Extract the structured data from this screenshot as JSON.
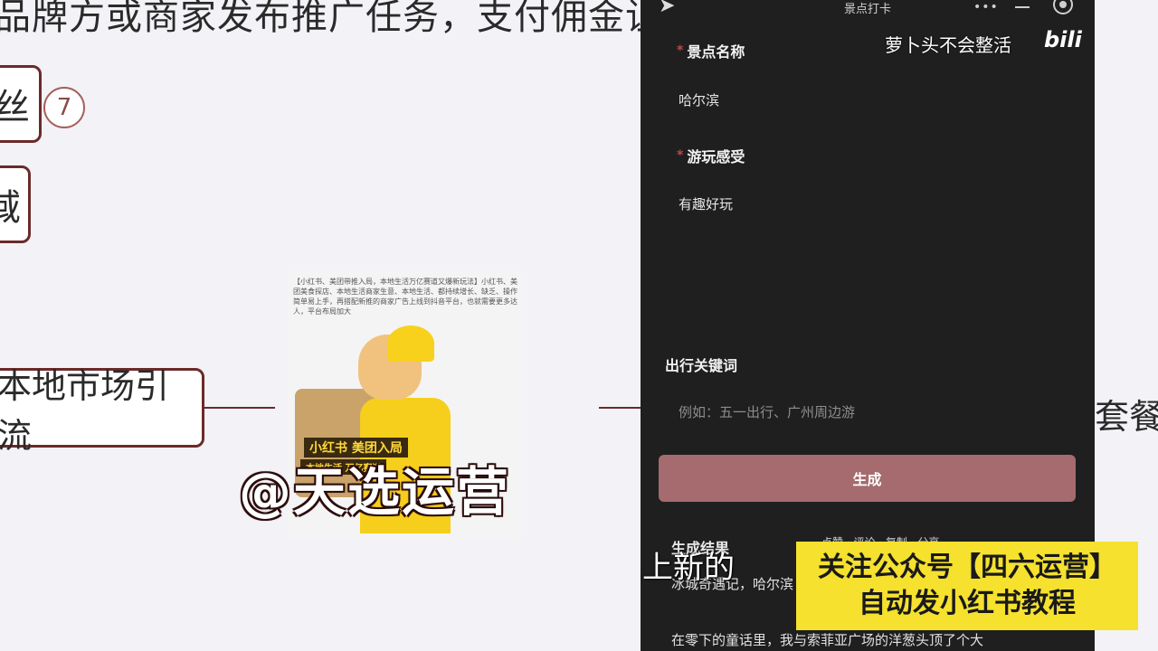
{
  "background": {
    "top_text": "品牌方或商家发布推广任务，支付佣金让达人",
    "node1": "丝",
    "badge": "7",
    "node2": "域",
    "node3": "本地市场引流",
    "right_text": "套餐"
  },
  "cover": {
    "description_text": "【小红书、美团带推入局，本地生活万亿赛道又爆新玩法】小红书、美团美食探店、本地生活商家生意、本地生活、都持续增长、缺乏、操作简单易上手，再搭配新推的商家广告上线到抖音平台，也就需要更多达人，平台布局加大",
    "caption1": "小红书 美团入局",
    "caption2": "本地生活 万亿赛道"
  },
  "watermark": "@天选运营",
  "panel": {
    "title": "景点打卡",
    "uploader": "萝卜头不会整活",
    "platform_logo": "bili",
    "fields": {
      "spot_name_label": "景点名称",
      "spot_name_value": "哈尔滨",
      "feeling_label": "游玩感受",
      "feeling_value": "有趣好玩",
      "keyword_label": "出行关键词",
      "keyword_placeholder": "例如：五一出行、广州周边游"
    },
    "generate_button": "生成",
    "result": {
      "label": "生成结果",
      "actions": "点赞 · 评论 · 复制 · 分享",
      "line1": "冰城奇遇记，哈尔滨",
      "line2": "在零下的童话里，我与索菲亚广场的洋葱头顶了个大"
    }
  },
  "subtitle": "上新的",
  "promo": {
    "line1": "关注公众号【四六运营】",
    "line2": "自动发小红书教程"
  }
}
